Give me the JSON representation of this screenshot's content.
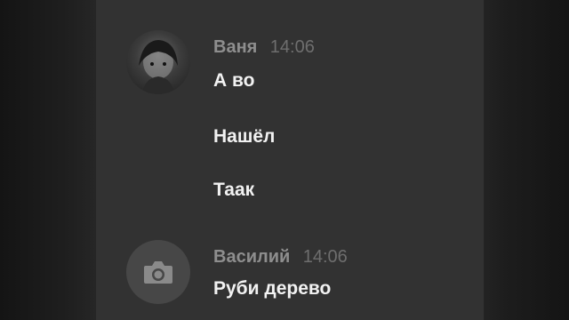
{
  "messages": [
    {
      "author": "Ваня",
      "time": "14:06",
      "avatar": "user-photo-avatar",
      "lines": [
        "А во",
        "Нашёл",
        "Таак"
      ]
    },
    {
      "author": "Василий",
      "time": "14:06",
      "avatar": "camera-icon",
      "lines": [
        "Руби дерево"
      ]
    }
  ],
  "colors": {
    "panel_background": "#323232",
    "author": "#8e8e8e",
    "timestamp": "#6e6e6e",
    "message_text": "#f2f2f2"
  }
}
